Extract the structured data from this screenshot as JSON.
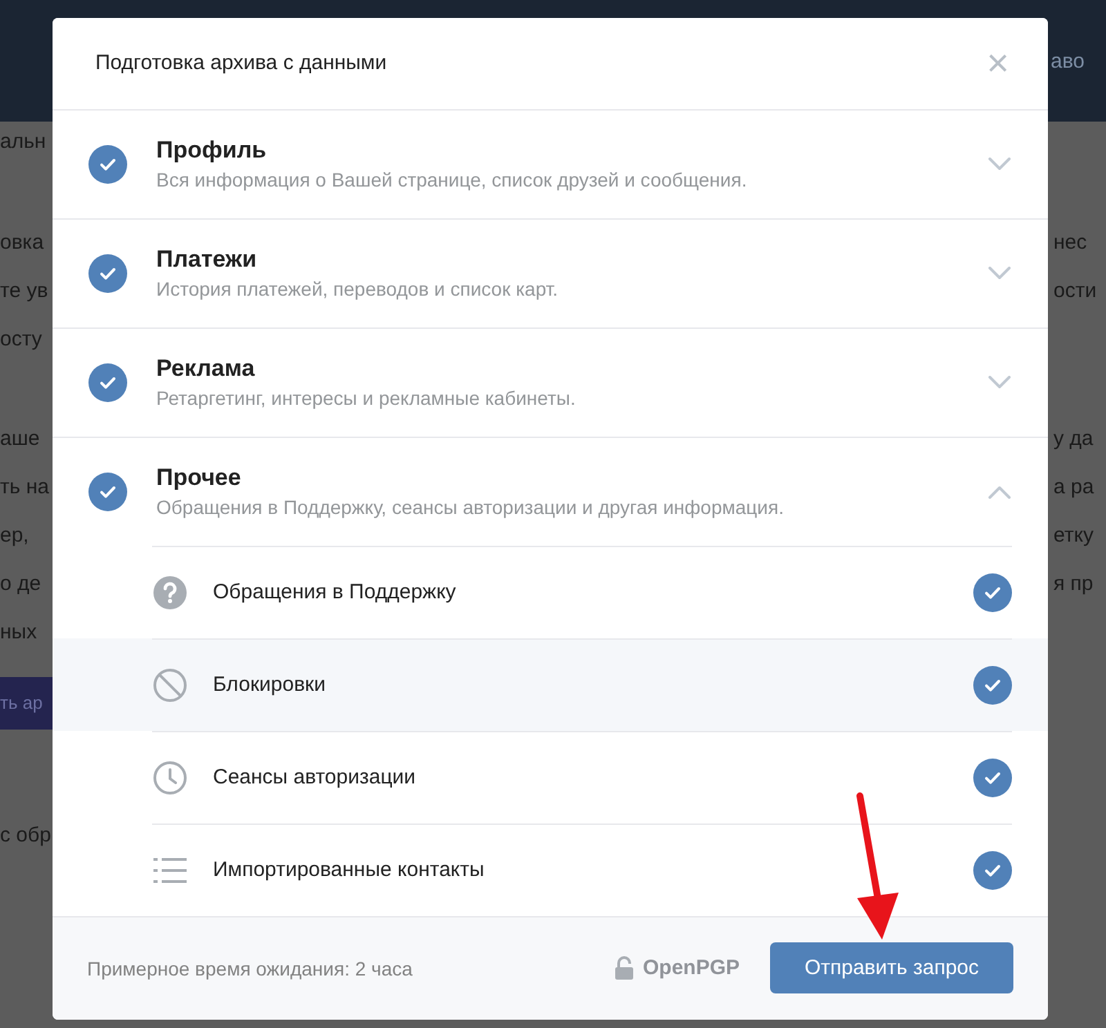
{
  "background": {
    "header_text": "аво",
    "left_paragraphs": [
      [
        "альн"
      ],
      [
        "овка",
        "те ув",
        "осту"
      ],
      [
        "аше",
        "ть на",
        "ер,",
        "о де",
        "ных"
      ]
    ],
    "left_button": "ть ар",
    "left_footer": "с обр",
    "right_paragraphs": [
      [
        "нес",
        "ости"
      ],
      [
        "у да",
        "а ра",
        "етку",
        "я пр"
      ]
    ]
  },
  "dialog": {
    "title": "Подготовка архива с данными",
    "close": "×",
    "sections": [
      {
        "title": "Профиль",
        "description": "Вся информация о Вашей странице, список друзей и сообщения.",
        "checked": true,
        "expanded": false
      },
      {
        "title": "Платежи",
        "description": "История платежей, переводов и список карт.",
        "checked": true,
        "expanded": false
      },
      {
        "title": "Реклама",
        "description": "Ретаргетинг, интересы и рекламные кабинеты.",
        "checked": true,
        "expanded": false
      },
      {
        "title": "Прочее",
        "description": "Обращения в Поддержку, сеансы авторизации и другая информация.",
        "checked": true,
        "expanded": true,
        "items": [
          {
            "kind": "question",
            "label": "Обращения в Поддержку",
            "checked": true,
            "selected": false
          },
          {
            "kind": "block",
            "label": "Блокировки",
            "checked": true,
            "selected": true
          },
          {
            "kind": "clock",
            "label": "Сеансы авторизации",
            "checked": true,
            "selected": false
          },
          {
            "kind": "list",
            "label": "Импортированные контакты",
            "checked": true,
            "selected": false
          }
        ]
      }
    ],
    "footer": {
      "wait_time": "Примерное время ожидания: 2 часа",
      "encryption": "OpenPGP",
      "submit": "Отправить запрос"
    }
  }
}
